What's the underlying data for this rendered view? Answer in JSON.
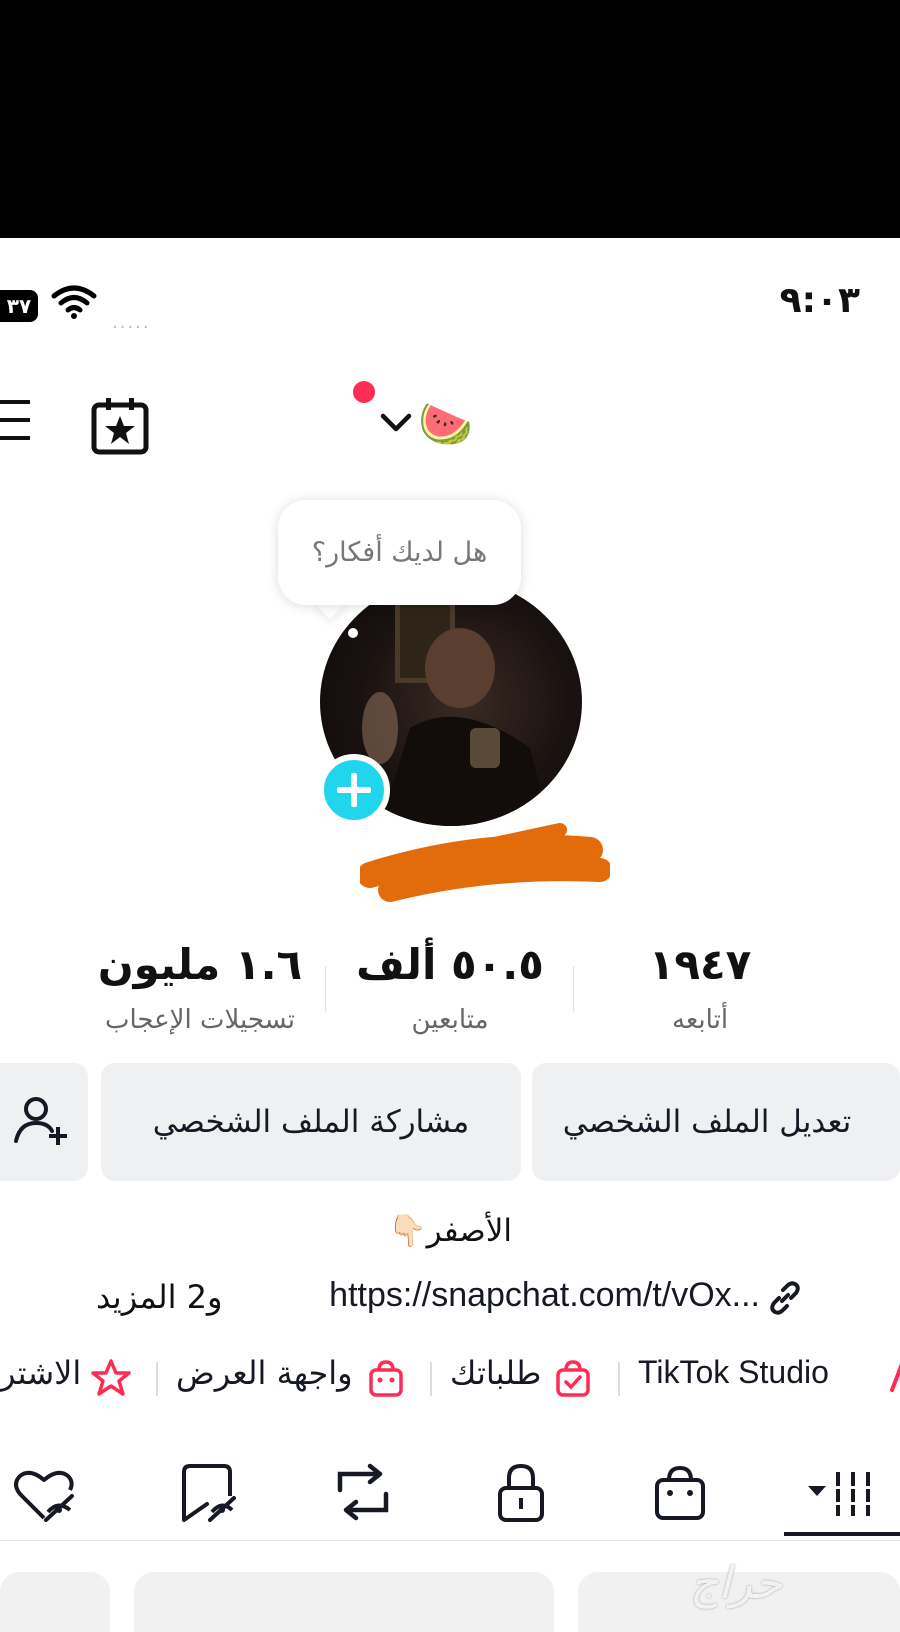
{
  "status_bar": {
    "time": "٩:٠٣",
    "battery": "٣٧",
    "signal_dots": "....."
  },
  "header": {
    "username_emoji": "🍉",
    "calendar_icon": "calendar-star-icon",
    "menu_icon": "hamburger-menu-icon"
  },
  "tooltip": {
    "text": "هل لديك أفكار؟"
  },
  "stats": {
    "following": {
      "value": "١٩٤٧",
      "label": "أتابعه"
    },
    "followers": {
      "value": "٥٠.٥ ألف",
      "label": "متابعين"
    },
    "likes": {
      "value": "١.٦ مليون",
      "label": "تسجيلات الإعجاب"
    }
  },
  "actions": {
    "edit_profile": "تعديل الملف الشخصي",
    "share_profile": "مشاركة الملف الشخصي"
  },
  "bio": {
    "text": "الأصفر👇🏻",
    "link": "https://snapchat.com/t/vOx...",
    "more": "و2 المزيد"
  },
  "chips": {
    "studio": "TikTok Studio",
    "orders": "طلباتك",
    "showcase": "واجهة العرض",
    "subscription": "الاشتر"
  },
  "colors": {
    "accent": "#fe2c55",
    "add_button": "#20d5ec",
    "button_bg": "#eff0f2",
    "redaction": "#e36c0a"
  },
  "watermark": "حراج"
}
